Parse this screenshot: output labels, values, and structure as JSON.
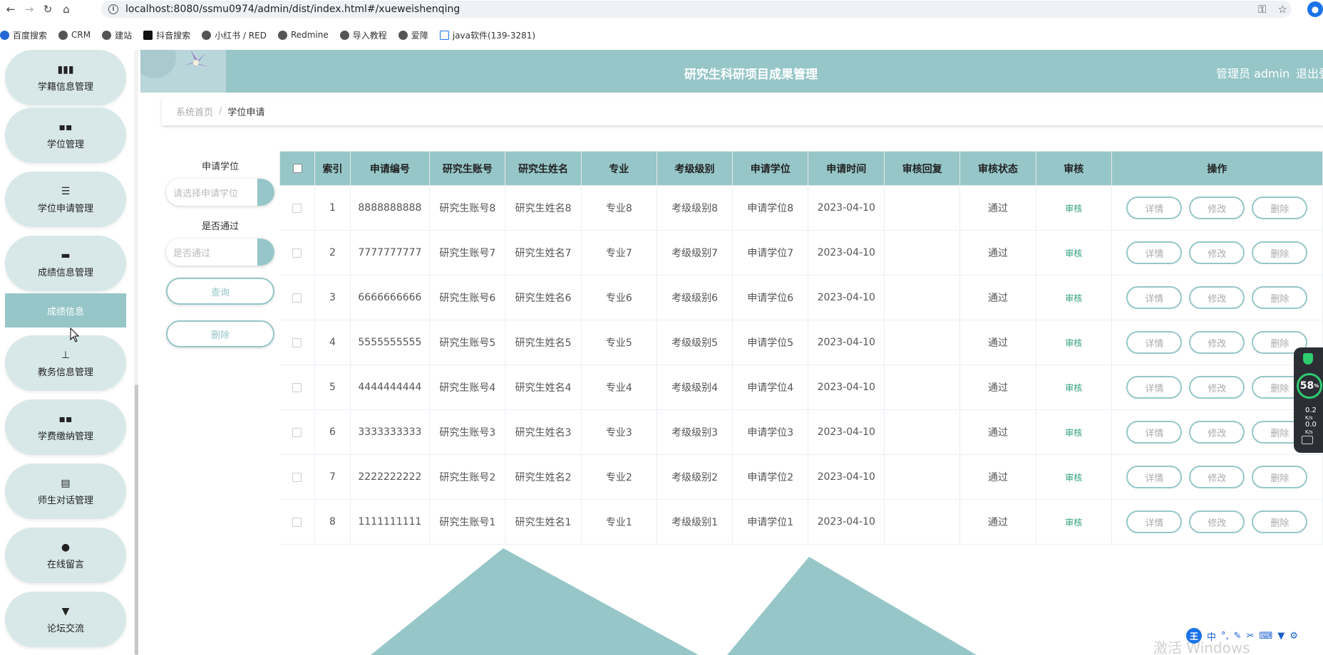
{
  "browser": {
    "url": "localhost:8080/ssmu0974/admin/dist/index.html#/xueweishenqing",
    "bookmarks": [
      "百度搜索",
      "CRM",
      "建站",
      "抖音搜索",
      "小红书 / RED",
      "Redmine",
      "导入教程",
      "爱障",
      "java软件(139-3281)"
    ]
  },
  "sidebar": {
    "items": [
      {
        "label": "学籍信息管理",
        "icon": "bar-chart-icon"
      },
      {
        "label": "学位管理",
        "icon": "grid-icon"
      },
      {
        "label": "学位申请管理",
        "icon": "list-icon"
      },
      {
        "label": "成绩信息管理",
        "icon": "monitor-icon"
      },
      {
        "label": "教务信息管理",
        "icon": "stamp-icon"
      },
      {
        "label": "学费缴纳管理",
        "icon": "grid-icon"
      },
      {
        "label": "师生对话管理",
        "icon": "clipboard-icon"
      },
      {
        "label": "在线留言",
        "icon": "bulb-icon"
      },
      {
        "label": "论坛交流",
        "icon": "pin-icon"
      }
    ],
    "sub_item": "成绩信息"
  },
  "header": {
    "title": "研究生科研项目成果管理",
    "admin": "管理员 admin",
    "logout": "退出登"
  },
  "breadcrumb": {
    "home": "系统首页",
    "separator": "/",
    "current": "学位申请"
  },
  "filters": {
    "degree_label": "申请学位",
    "degree_placeholder": "请选择申请学位",
    "pass_label": "是否通过",
    "pass_placeholder": "是否通过",
    "query_button": "查询",
    "delete_button": "删除"
  },
  "table": {
    "headers": [
      "索引",
      "申请编号",
      "研究生账号",
      "研究生姓名",
      "专业",
      "考级级别",
      "申请学位",
      "申请时间",
      "审核回复",
      "审核状态",
      "审核",
      "操作"
    ],
    "rows": [
      {
        "index": "1",
        "code": "8888888888",
        "account": "研究生账号8",
        "name": "研究生姓名8",
        "major": "专业8",
        "level": "考级级别8",
        "degree": "申请学位8",
        "date": "2023-04-10",
        "reply": "",
        "status": "通过",
        "audit": "审核"
      },
      {
        "index": "2",
        "code": "7777777777",
        "account": "研究生账号7",
        "name": "研究生姓名7",
        "major": "专业7",
        "level": "考级级别7",
        "degree": "申请学位7",
        "date": "2023-04-10",
        "reply": "",
        "status": "通过",
        "audit": "审核"
      },
      {
        "index": "3",
        "code": "6666666666",
        "account": "研究生账号6",
        "name": "研究生姓名6",
        "major": "专业6",
        "level": "考级级别6",
        "degree": "申请学位6",
        "date": "2023-04-10",
        "reply": "",
        "status": "通过",
        "audit": "审核"
      },
      {
        "index": "4",
        "code": "5555555555",
        "account": "研究生账号5",
        "name": "研究生姓名5",
        "major": "专业5",
        "level": "考级级别5",
        "degree": "申请学位5",
        "date": "2023-04-10",
        "reply": "",
        "status": "通过",
        "audit": "审核"
      },
      {
        "index": "5",
        "code": "4444444444",
        "account": "研究生账号4",
        "name": "研究生姓名4",
        "major": "专业4",
        "level": "考级级别4",
        "degree": "申请学位4",
        "date": "2023-04-10",
        "reply": "",
        "status": "通过",
        "audit": "审核"
      },
      {
        "index": "6",
        "code": "3333333333",
        "account": "研究生账号3",
        "name": "研究生姓名3",
        "major": "专业3",
        "level": "考级级别3",
        "degree": "申请学位3",
        "date": "2023-04-10",
        "reply": "",
        "status": "通过",
        "audit": "审核"
      },
      {
        "index": "7",
        "code": "2222222222",
        "account": "研究生账号2",
        "name": "研究生姓名2",
        "major": "专业2",
        "level": "考级级别2",
        "degree": "申请学位2",
        "date": "2023-04-10",
        "reply": "",
        "status": "通过",
        "audit": "审核"
      },
      {
        "index": "8",
        "code": "1111111111",
        "account": "研究生账号1",
        "name": "研究生姓名1",
        "major": "专业1",
        "level": "考级级别1",
        "degree": "申请学位1",
        "date": "2023-04-10",
        "reply": "",
        "status": "通过",
        "audit": "审核"
      }
    ],
    "actions": {
      "detail": "详情",
      "edit": "修改",
      "delete": "删除"
    }
  },
  "widget": {
    "percent": "58",
    "percent_unit": "%",
    "net1": "0.2",
    "net2": "0.0",
    "net_unit": "K/s"
  },
  "watermark": "激活 Windows",
  "ime": {
    "logo": "王",
    "lang": "中"
  },
  "colors": {
    "accent": "#96c6c8",
    "menu_bg": "#d8e8e8",
    "audit_link": "#2f9e7a"
  }
}
